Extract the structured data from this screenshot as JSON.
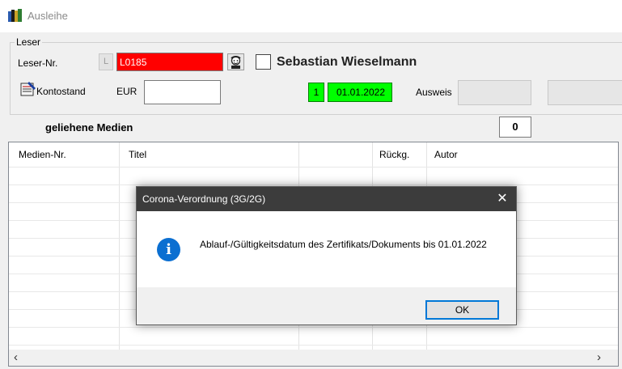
{
  "window": {
    "title": "Ausleihe"
  },
  "leser": {
    "group_label": "Leser",
    "nr_label": "Leser-Nr.",
    "l_badge": "L",
    "nr_value": "L0185",
    "name": "Sebastian Wieselmann",
    "konto_label": "Kontostand",
    "eur_label": "EUR",
    "eur_value": "",
    "status_num": "1",
    "status_date": "01.01.2022",
    "ausweis_label": "Ausweis"
  },
  "medien": {
    "title": "geliehene Medien",
    "count": "0",
    "columns": [
      "Medien-Nr.",
      "Titel",
      "Rückg.",
      "Autor"
    ]
  },
  "dialog": {
    "title": "Corona-Verordnung (3G/2G)",
    "close": "✕",
    "message": "Ablauf-/Gültigkeitsdatum des Zertifikats/Dokuments bis 01.01.2022",
    "ok_label": "OK",
    "info_glyph": "i"
  },
  "icons": {
    "app": "books-icon",
    "konto": "ledger-icon",
    "face": "face-icon",
    "info": "info-icon",
    "scroll_left": "‹",
    "scroll_right": "›"
  },
  "colors": {
    "leser_nr_bg": "#ff0000",
    "status_bg": "#00ff00",
    "dialog_title_bg": "#3c3c3c",
    "ok_border": "#0078d7",
    "info_icon": "#0b6fd1"
  }
}
